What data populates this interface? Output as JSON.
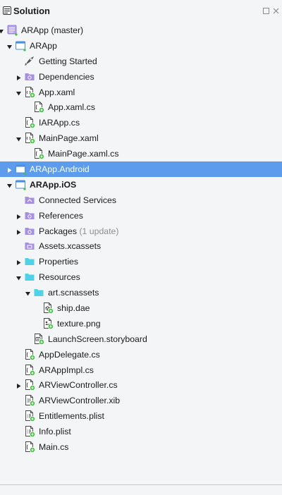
{
  "panel": {
    "title": "Solution"
  },
  "tree": [
    {
      "label": "ARApp (master)",
      "extra": "",
      "level": 0,
      "disc": "down",
      "icon": "solution-icon",
      "bold": false,
      "selected": false
    },
    {
      "label": "ARApp",
      "extra": "",
      "level": 1,
      "disc": "down",
      "icon": "project-icon",
      "bold": false,
      "selected": false
    },
    {
      "label": "Getting Started",
      "extra": "",
      "level": 2,
      "disc": "",
      "icon": "rocket-icon",
      "bold": false,
      "selected": false
    },
    {
      "label": "Dependencies",
      "extra": "",
      "level": 2,
      "disc": "right",
      "icon": "folder-purple-icon",
      "bold": false,
      "selected": false
    },
    {
      "label": "App.xaml",
      "extra": "",
      "level": 2,
      "disc": "down",
      "icon": "xaml-file-icon",
      "bold": false,
      "selected": false
    },
    {
      "label": "App.xaml.cs",
      "extra": "",
      "level": 3,
      "disc": "",
      "icon": "cs-file-icon",
      "bold": false,
      "selected": false
    },
    {
      "label": "IARApp.cs",
      "extra": "",
      "level": 2,
      "disc": "",
      "icon": "cs-file-icon",
      "bold": false,
      "selected": false
    },
    {
      "label": "MainPage.xaml",
      "extra": "",
      "level": 2,
      "disc": "down",
      "icon": "xaml-file-icon",
      "bold": false,
      "selected": false
    },
    {
      "label": "MainPage.xaml.cs",
      "extra": "",
      "level": 3,
      "disc": "",
      "icon": "cs-file-icon",
      "bold": false,
      "selected": false
    },
    {
      "label": "ARApp.Android",
      "extra": "",
      "level": 1,
      "disc": "right",
      "icon": "project-icon",
      "bold": false,
      "selected": true
    },
    {
      "label": "ARApp.iOS",
      "extra": "",
      "level": 1,
      "disc": "down",
      "icon": "project-icon",
      "bold": true,
      "selected": false
    },
    {
      "label": "Connected Services",
      "extra": "",
      "level": 2,
      "disc": "",
      "icon": "services-icon",
      "bold": false,
      "selected": false
    },
    {
      "label": "References",
      "extra": "",
      "level": 2,
      "disc": "right",
      "icon": "folder-purple-icon",
      "bold": false,
      "selected": false
    },
    {
      "label": "Packages",
      "extra": "(1 update)",
      "level": 2,
      "disc": "right",
      "icon": "folder-purple-icon",
      "bold": false,
      "selected": false
    },
    {
      "label": "Assets.xcassets",
      "extra": "",
      "level": 2,
      "disc": "",
      "icon": "assets-icon",
      "bold": false,
      "selected": false
    },
    {
      "label": "Properties",
      "extra": "",
      "level": 2,
      "disc": "right",
      "icon": "folder-cyan-icon",
      "bold": false,
      "selected": false
    },
    {
      "label": "Resources",
      "extra": "",
      "level": 2,
      "disc": "down",
      "icon": "folder-cyan-icon",
      "bold": false,
      "selected": false
    },
    {
      "label": "art.scnassets",
      "extra": "",
      "level": 3,
      "disc": "down",
      "icon": "folder-cyan-icon",
      "bold": false,
      "selected": false
    },
    {
      "label": "ship.dae",
      "extra": "",
      "level": 4,
      "disc": "",
      "icon": "model-file-icon",
      "bold": false,
      "selected": false
    },
    {
      "label": "texture.png",
      "extra": "",
      "level": 4,
      "disc": "",
      "icon": "image-file-icon",
      "bold": false,
      "selected": false
    },
    {
      "label": "LaunchScreen.storyboard",
      "extra": "",
      "level": 3,
      "disc": "",
      "icon": "storyboard-file-icon",
      "bold": false,
      "selected": false
    },
    {
      "label": "AppDelegate.cs",
      "extra": "",
      "level": 2,
      "disc": "",
      "icon": "cs-file-icon",
      "bold": false,
      "selected": false
    },
    {
      "label": "ARAppImpl.cs",
      "extra": "",
      "level": 2,
      "disc": "",
      "icon": "cs-file-icon",
      "bold": false,
      "selected": false
    },
    {
      "label": "ARViewController.cs",
      "extra": "",
      "level": 2,
      "disc": "right",
      "icon": "cs-file-icon",
      "bold": false,
      "selected": false
    },
    {
      "label": "ARViewController.xib",
      "extra": "",
      "level": 2,
      "disc": "",
      "icon": "xib-file-icon",
      "bold": false,
      "selected": false
    },
    {
      "label": "Entitlements.plist",
      "extra": "",
      "level": 2,
      "disc": "",
      "icon": "plist-file-icon",
      "bold": false,
      "selected": false
    },
    {
      "label": "Info.plist",
      "extra": "",
      "level": 2,
      "disc": "",
      "icon": "plist-file-icon",
      "bold": false,
      "selected": false
    },
    {
      "label": "Main.cs",
      "extra": "",
      "level": 2,
      "disc": "",
      "icon": "cs-file-icon",
      "bold": false,
      "selected": false
    }
  ],
  "colors": {
    "background": "#f4f5f6",
    "selection": "#5d9cec",
    "project_icon": "#4a90e2",
    "folder_purple": "#a68fe3",
    "folder_cyan": "#4fd1e8",
    "badge_green": "#3cc23c",
    "secondary_text": "#8e8e8e"
  }
}
